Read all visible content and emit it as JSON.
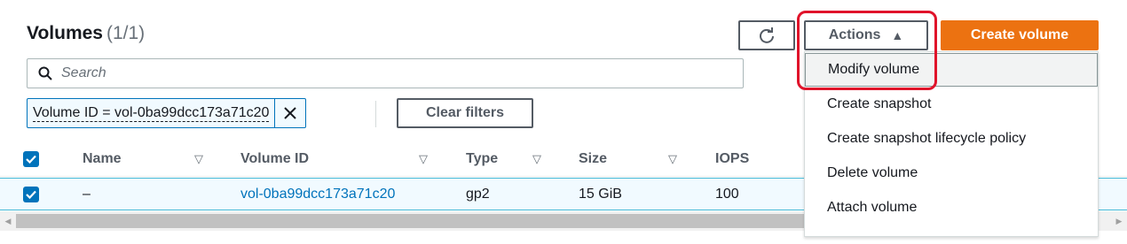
{
  "header": {
    "title": "Volumes",
    "count": "(1/1)",
    "actions_label": "Actions",
    "create_label": "Create volume",
    "accent_color": "#ec7211",
    "refresh_icon": "refresh-icon"
  },
  "search": {
    "placeholder": "Search"
  },
  "filter": {
    "token": "Volume ID = vol-0ba99dcc173a71c20",
    "clear_label": "Clear filters"
  },
  "table": {
    "columns": [
      "Name",
      "Volume ID",
      "Type",
      "Size",
      "IOPS"
    ],
    "rows": [
      {
        "name": "–",
        "volume_id": "vol-0ba99dcc173a71c20",
        "type": "gp2",
        "size": "15 GiB",
        "iops": "100",
        "selected": true
      }
    ]
  },
  "actions_menu": {
    "items": [
      {
        "label": "Modify volume"
      },
      {
        "label": "Create snapshot"
      },
      {
        "label": "Create snapshot lifecycle policy"
      },
      {
        "label": "Delete volume"
      },
      {
        "label": "Attach volume"
      }
    ]
  }
}
